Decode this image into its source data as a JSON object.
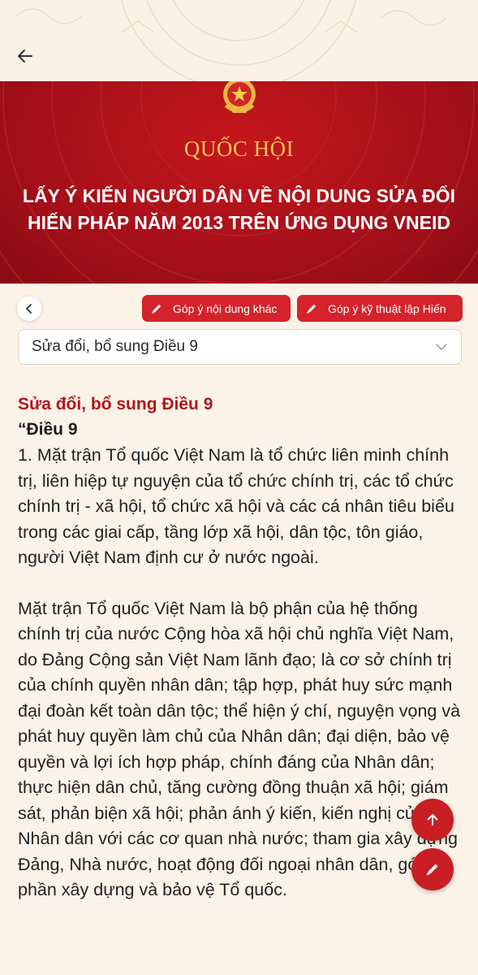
{
  "header": {
    "back_icon": "arrow-left-icon"
  },
  "banner": {
    "org": "QUỐC HỘI",
    "title": "LẤY Ý KIẾN NGƯỜI DÂN VỀ NỘI DUNG SỬA ĐỔI HIẾN PHÁP NĂM 2013 TRÊN ỨNG DỤNG VNEID",
    "emblem_icon": "national-emblem-icon"
  },
  "toolbar": {
    "back_icon": "chevron-left-icon",
    "button_other": "Góp ý nội dung khác",
    "button_technique": "Góp ý kỹ thuật lập Hiến",
    "button_icon": "pencil-icon"
  },
  "select": {
    "value": "Sửa đổi, bổ sung Điều 9",
    "icon": "chevron-down-icon"
  },
  "content": {
    "section_title": "Sửa đổi, bổ sung Điều 9",
    "article_title": "“Điều 9",
    "paragraph_1": "1. Mặt trận Tổ quốc Việt Nam là tổ chức liên minh chính trị, liên hiệp tự nguyện của tổ chức chính trị, các tổ chức chính trị - xã hội, tổ chức xã hội và các cá nhân tiêu biểu trong các giai cấp, tầng lớp xã hội, dân tộc, tôn giáo, người Việt Nam định cư ở nước ngoài.",
    "paragraph_2": "Mặt trận Tổ quốc Việt Nam là bộ phận của hệ thống chính trị của nước Cộng hòa xã hội chủ nghĩa Việt Nam, do Đảng Cộng sản Việt Nam lãnh đạo; là cơ sở chính trị của chính quyền nhân dân; tập hợp, phát huy sức mạnh đại đoàn kết toàn dân tộc; thể hiện ý chí, nguyện vọng và phát huy quyền làm chủ của Nhân dân; đại diện, bảo vệ quyền và lợi ích hợp pháp, chính đáng của Nhân dân; thực hiện dân chủ, tăng cường đồng thuận xã hội; giám sát, phản biện xã hội; phản ánh ý kiến, kiến nghị của Nhân dân với các cơ quan nhà nước; tham gia xây dựng Đảng, Nhà nước, hoạt động đối ngoại nhân dân, góp phần xây dựng và bảo vệ Tổ quốc."
  },
  "fabs": {
    "scroll_top_icon": "arrow-up-icon",
    "edit_icon": "pencil-icon"
  },
  "colors": {
    "brand_red": "#c81e24",
    "banner_red": "#a8101a",
    "gold": "#f1c25a",
    "background": "#fbf3e7"
  }
}
